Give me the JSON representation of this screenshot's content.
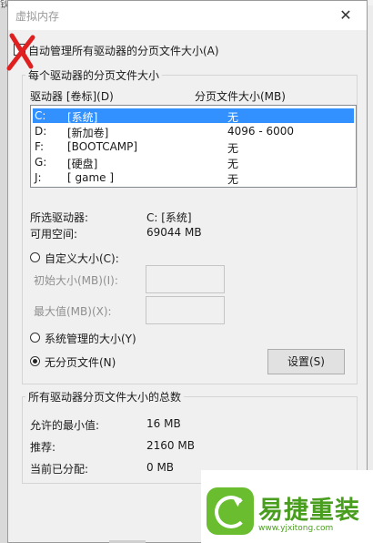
{
  "background": {
    "glyph": "钬"
  },
  "window": {
    "title": "虚拟内存",
    "close_glyph": "✕"
  },
  "auto_manage": {
    "label": "自动管理所有驱动器的分页文件大小(A)",
    "checked": false
  },
  "per_drive": {
    "group_label": "每个驱动器的分页文件大小",
    "col_drive": "驱动器 [卷标](D)",
    "col_size": "分页文件大小(MB)",
    "drives": [
      {
        "letter": "C:",
        "label": "[系统]",
        "size": "无",
        "selected": true
      },
      {
        "letter": "D:",
        "label": "[新加卷]",
        "size": "4096 - 6000",
        "selected": false
      },
      {
        "letter": "F:",
        "label": "[BOOTCAMP]",
        "size": "无",
        "selected": false
      },
      {
        "letter": "G:",
        "label": "[硬盘]",
        "size": "无",
        "selected": false
      },
      {
        "letter": "J:",
        "label": "[ game ]",
        "size": "无",
        "selected": false
      }
    ],
    "selected_drive_label": "所选驱动器:",
    "selected_drive_value": "C:  [系统]",
    "free_space_label": "可用空间:",
    "free_space_value": "69044 MB",
    "custom_size_label": "自定义大小(C):",
    "initial_size_label": "初始大小(MB)(I):",
    "max_size_label": "最大值(MB)(X):",
    "system_managed_label": "系统管理的大小(Y)",
    "no_paging_label": "无分页文件(N)",
    "selected_option": "no_paging",
    "set_button": "设置(S)"
  },
  "totals": {
    "group_label": "所有驱动器分页文件大小的总数",
    "min_label": "允许的最小值:",
    "min_value": "16 MB",
    "recommended_label": "推荐:",
    "recommended_value": "2160 MB",
    "allocated_label": "当前已分配:",
    "allocated_value": "0 MB"
  },
  "watermark": {
    "brand": "易捷重装",
    "url": "www.yjxitong.com"
  },
  "colors": {
    "selection": "#3390ff",
    "mark": "#e02020",
    "watermark": "#4a9e1f"
  }
}
